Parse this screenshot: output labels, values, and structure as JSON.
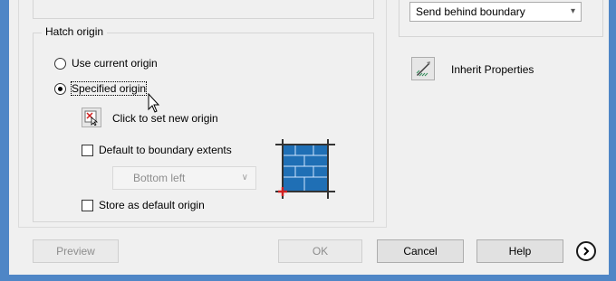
{
  "draw_order": {
    "selected": "Send behind boundary"
  },
  "hatch_origin": {
    "title": "Hatch origin",
    "use_current_origin": "Use current origin",
    "specified_origin": "Specified origin",
    "click_to_set": "Click to set new origin",
    "default_to_boundary": "Default to boundary extents",
    "boundary_position": "Bottom left",
    "store_as_default": "Store as default origin"
  },
  "inherit": {
    "label": "Inherit Properties"
  },
  "buttons": {
    "preview": "Preview",
    "ok": "OK",
    "cancel": "Cancel",
    "help": "Help"
  },
  "colors": {
    "frame": "#4f86c6",
    "dialog_bg": "#f0f0f0",
    "preview_blue": "#1f6fb5"
  }
}
